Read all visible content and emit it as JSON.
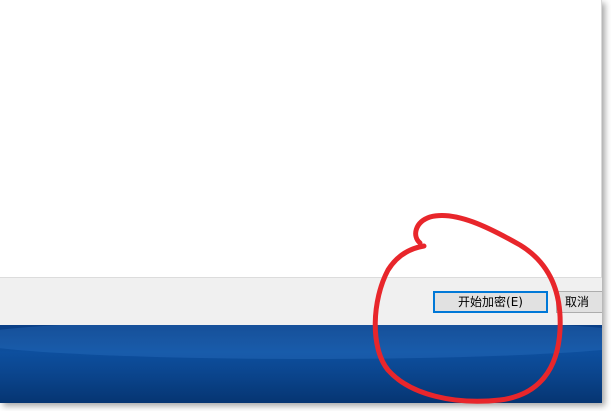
{
  "dialog": {
    "buttons": {
      "start_encrypt_label": "开始加密(E)",
      "cancel_label": "取消"
    }
  },
  "colors": {
    "focus_border": "#0078d7",
    "annotation_stroke": "#e8262b",
    "desktop_blue": "#0b468f"
  }
}
